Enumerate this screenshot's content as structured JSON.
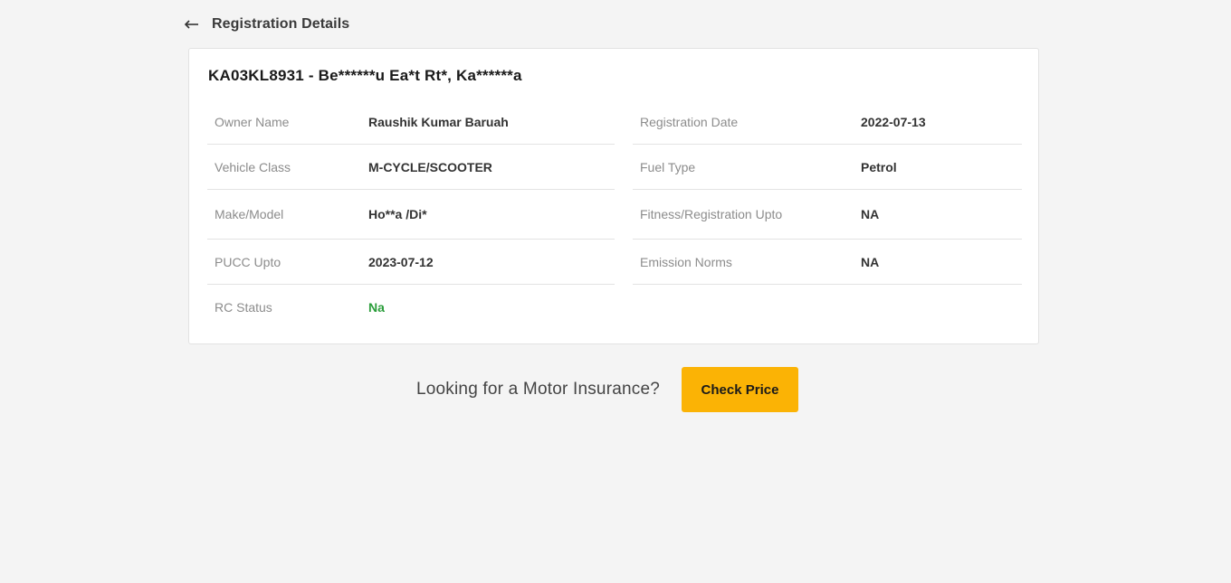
{
  "header": {
    "back_icon": "arrow-left-icon",
    "title": "Registration Details"
  },
  "card": {
    "title": "KA03KL8931 - Be******u Ea*t Rt*, Ka******a",
    "left": [
      {
        "label": "Owner Name",
        "value": "Raushik Kumar Baruah"
      },
      {
        "label": "Vehicle Class",
        "value": "M-CYCLE/SCOOTER"
      },
      {
        "label": "Make/Model",
        "value": "Ho**a /Di*"
      },
      {
        "label": "PUCC Upto",
        "value": "2023-07-12"
      },
      {
        "label": "RC Status",
        "value": "Na"
      }
    ],
    "right": [
      {
        "label": "Registration Date",
        "value": "2022-07-13"
      },
      {
        "label": "Fuel Type",
        "value": "Petrol"
      },
      {
        "label": "Fitness/Registration Upto",
        "value": "NA"
      },
      {
        "label": "Emission Norms",
        "value": "NA"
      }
    ]
  },
  "cta": {
    "text": "Looking for a Motor Insurance?",
    "button_label": "Check Price"
  },
  "colors": {
    "background": "#f4f4f4",
    "accent": "#fbb305",
    "status_green": "#2a9d3a"
  }
}
